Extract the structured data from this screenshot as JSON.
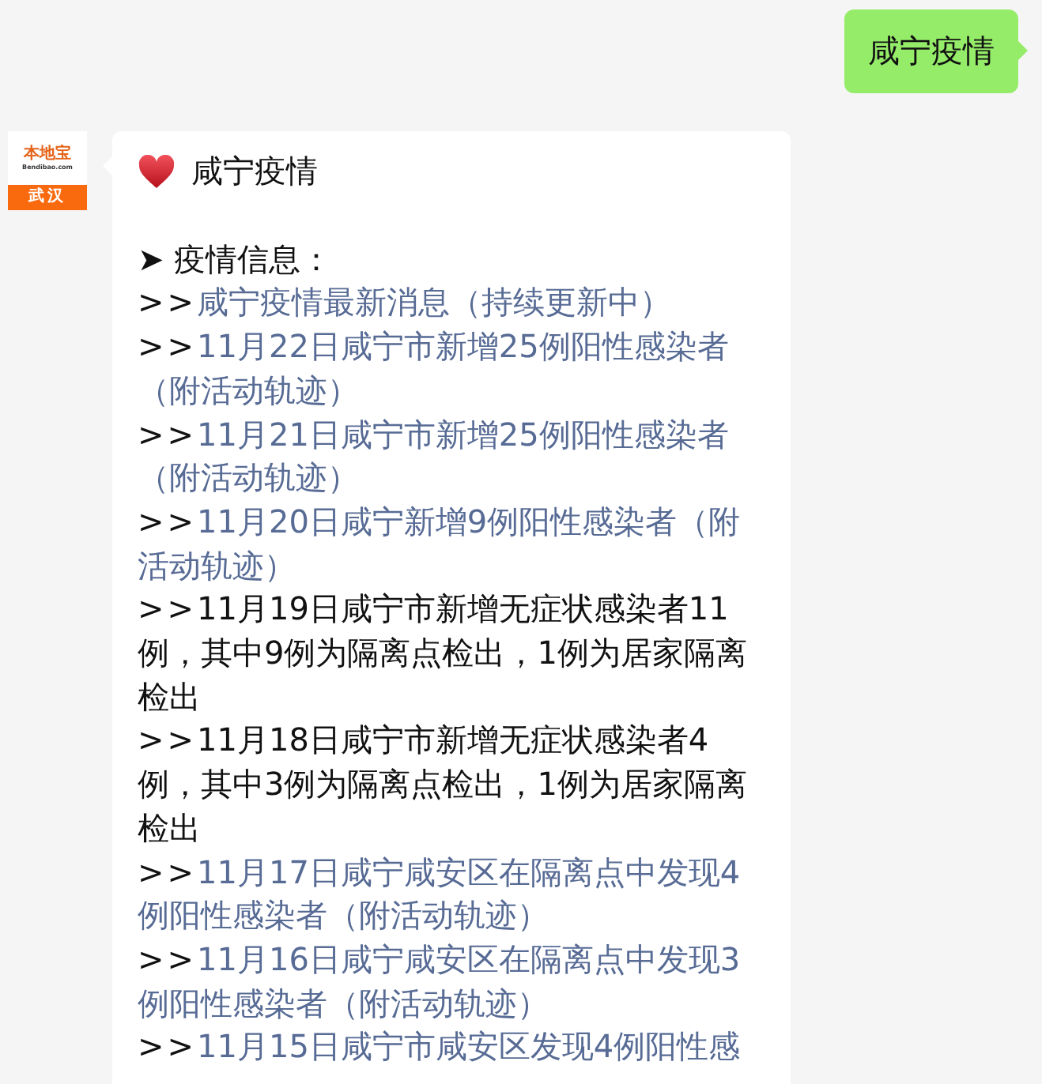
{
  "sent_message": {
    "text": "咸宁疫情"
  },
  "sender": {
    "logo_text": "本地宝",
    "logo_site": "Bendibao.com",
    "city": "武汉"
  },
  "reply": {
    "title": "咸宁疫情",
    "section": "➤ 疫情信息：",
    "items": [
      {
        "prefix": ">>",
        "text": "咸宁疫情最新消息（持续更新中）",
        "kind": "link"
      },
      {
        "prefix": ">>",
        "text": "11月22日咸宁市新增25例阳性感染者（附活动轨迹）",
        "kind": "link"
      },
      {
        "prefix": ">>",
        "text": "11月21日咸宁市新增25例阳性感染者（附活动轨迹）",
        "kind": "link"
      },
      {
        "prefix": ">>",
        "text": "11月20日咸宁新增9例阳性感染者（附活动轨迹）",
        "kind": "link"
      },
      {
        "prefix": ">>",
        "text": "11月19日咸宁市新增无症状感染者11例，其中9例为隔离点检出，1例为居家隔离检出",
        "kind": "plain"
      },
      {
        "prefix": ">>",
        "text": "11月18日咸宁市新增无症状感染者4例，其中3例为隔离点检出，1例为居家隔离检出",
        "kind": "plain"
      },
      {
        "prefix": ">>",
        "text": "11月17日咸宁咸安区在隔离点中发现4例阳性感染者（附活动轨迹）",
        "kind": "link"
      },
      {
        "prefix": ">>",
        "text": "11月16日咸宁咸安区在隔离点中发现3例阳性感染者（附活动轨迹）",
        "kind": "link"
      },
      {
        "prefix": ">>",
        "text": "11月15日咸宁市咸安区发现4例阳性感",
        "kind": "link"
      }
    ]
  }
}
